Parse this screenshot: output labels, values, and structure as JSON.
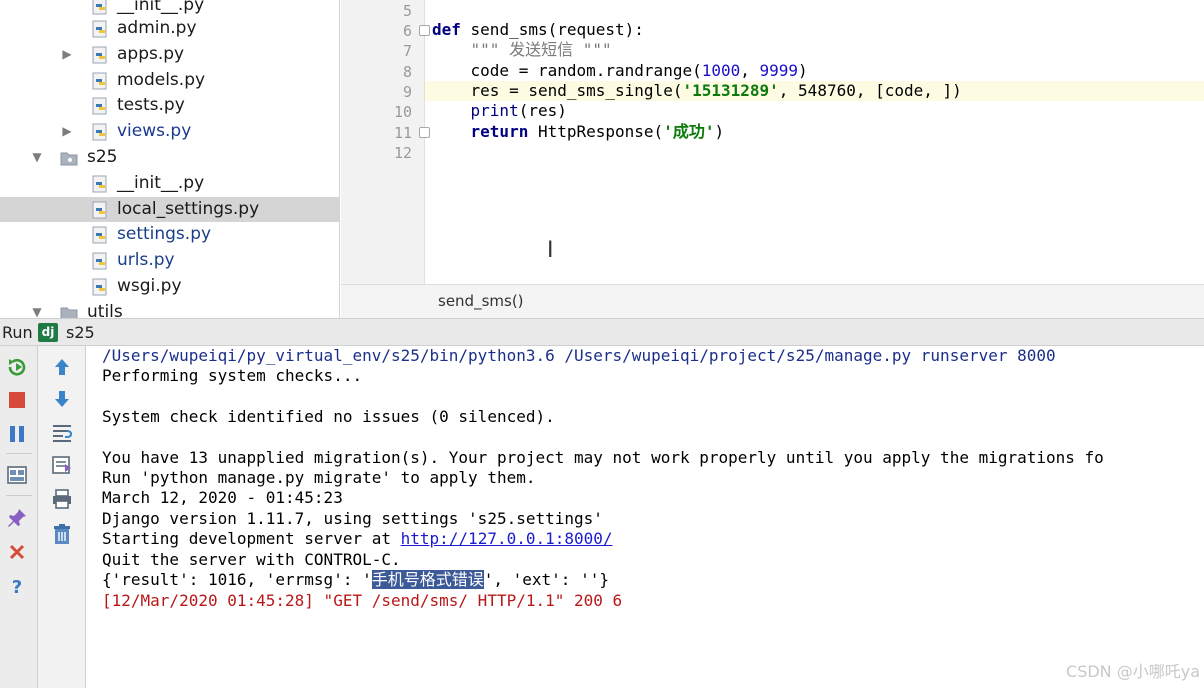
{
  "project_tree": {
    "items": [
      {
        "label": "__init__.py",
        "type": "python-file-icon",
        "arrow": ""
      },
      {
        "label": "admin.py",
        "type": "python-file-icon",
        "arrow": ""
      },
      {
        "label": "apps.py",
        "type": "python-file-icon",
        "arrow": "▶"
      },
      {
        "label": "models.py",
        "type": "python-file-icon",
        "arrow": ""
      },
      {
        "label": "tests.py",
        "type": "python-file-icon",
        "arrow": ""
      },
      {
        "label": "views.py",
        "type": "python-file-icon",
        "arrow": "▶"
      },
      {
        "label": "s25",
        "type": "folder-icon",
        "arrow": "▼"
      },
      {
        "label": "__init__.py",
        "type": "python-file-icon",
        "arrow": ""
      },
      {
        "label": "local_settings.py",
        "type": "python-file-icon",
        "arrow": ""
      },
      {
        "label": "settings.py",
        "type": "python-file-icon",
        "arrow": ""
      },
      {
        "label": "urls.py",
        "type": "python-file-icon",
        "arrow": ""
      },
      {
        "label": "wsgi.py",
        "type": "python-file-icon",
        "arrow": ""
      },
      {
        "label": "utils",
        "type": "folder-icon",
        "arrow": "▼"
      }
    ],
    "selected_item": "local_settings.py"
  },
  "editor": {
    "line_numbers": [
      "5",
      "6",
      "7",
      "8",
      "9",
      "10",
      "11",
      "12"
    ],
    "current_line": "9",
    "code": {
      "l6_kw": "def",
      "l6_rest": " send_sms(request):",
      "l7": "    \"\"\" 发送短信 \"\"\"",
      "l8_a": "    code = random.randrange(",
      "l8_n1": "1000",
      "l8_b": ", ",
      "l8_n2": "9999",
      "l8_c": ")",
      "l9_a": "    res = send_sms_single(",
      "l9_s": "'15131289'",
      "l9_b": ", 548760, [code, ])",
      "l10_indent": "    ",
      "l10_kw": "print",
      "l10_rest": "(res)",
      "l11_indent": "    ",
      "l11_kw": "return",
      "l11_rest": " HttpResponse(",
      "l11_s": "'成功'",
      "l11_end": ")"
    },
    "breadcrumb": "send_sms()"
  },
  "run_panel": {
    "run_label": "Run",
    "dj_badge": "dj",
    "config_name": "s25"
  },
  "console": {
    "line1": "/Users/wupeiqi/py_virtual_env/s25/bin/python3.6 /Users/wupeiqi/project/s25/manage.py runserver 8000",
    "line2": "Performing system checks...",
    "line3": "System check identified no issues (0 silenced).",
    "line4": "You have 13 unapplied migration(s). Your project may not work properly until you apply the migrations fo",
    "line5": "Run 'python manage.py migrate' to apply them.",
    "line6": "March 12, 2020 - 01:45:23",
    "line7": "Django version 1.11.7, using settings 's25.settings'",
    "line8_prefix": "Starting development server at ",
    "line8_link": "http://127.0.0.1:8000/",
    "line9": "Quit the server with CONTROL-C.",
    "line10_prefix": "{'result': 1016, 'errmsg': '",
    "line10_highlight": "手机号格式错误",
    "line10_suffix": "', 'ext': ''}",
    "line11": "[12/Mar/2020 01:45:28] \"GET /send/sms/ HTTP/1.1\" 200 6"
  },
  "watermark": "CSDN @小哪吒ya",
  "colors": {
    "keyword": "#000080",
    "string": "#0b7a0b",
    "number": "#1a0dc9",
    "console_error": "#b81818",
    "console_path": "#1b2f8a",
    "selection_highlight": "#3d5a98",
    "selected_tree_row": "#d5d5d5"
  }
}
